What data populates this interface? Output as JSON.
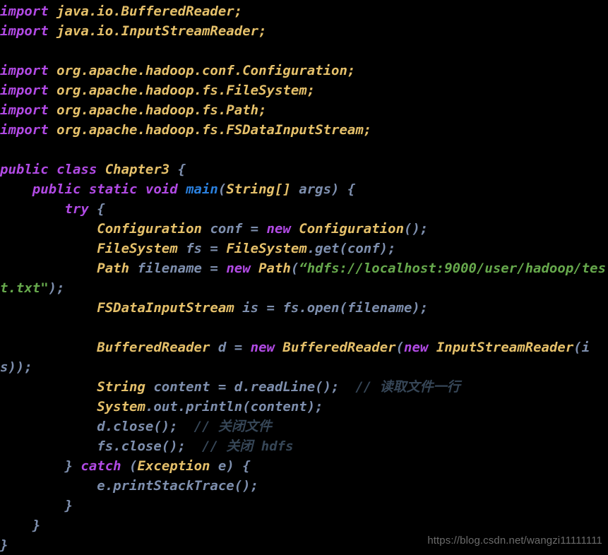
{
  "editor": {
    "background_color": "#000000",
    "language": "java",
    "font_size_px": 19,
    "line_height_px": 28
  },
  "palette": {
    "keyword": "#b14ae4",
    "type": "#e5c06a",
    "variable": "#7e8fae",
    "function": "#2a7fdc",
    "string": "#66a84c",
    "comment": "#364657",
    "punctuation": "#7e8fae",
    "watermark": "#6b6b6b"
  },
  "code": {
    "lines": [
      {
        "index": 1,
        "text": "import java.io.BufferedReader;",
        "tokens": [
          {
            "t": "import",
            "c": "t-kw"
          },
          {
            "t": " ",
            "c": "t-pun"
          },
          {
            "t": "java.io.BufferedReader;",
            "c": "t-type"
          }
        ]
      },
      {
        "index": 2,
        "text": "import java.io.InputStreamReader;",
        "tokens": [
          {
            "t": "import",
            "c": "t-kw"
          },
          {
            "t": " ",
            "c": "t-pun"
          },
          {
            "t": "java.io.InputStreamReader;",
            "c": "t-type"
          }
        ]
      },
      {
        "index": 3,
        "text": "",
        "tokens": []
      },
      {
        "index": 4,
        "text": "import org.apache.hadoop.conf.Configuration;",
        "tokens": [
          {
            "t": "import",
            "c": "t-kw"
          },
          {
            "t": " ",
            "c": "t-pun"
          },
          {
            "t": "org.apache.hadoop.conf.Configuration;",
            "c": "t-type"
          }
        ]
      },
      {
        "index": 5,
        "text": "import org.apache.hadoop.fs.FileSystem;",
        "tokens": [
          {
            "t": "import",
            "c": "t-kw"
          },
          {
            "t": " ",
            "c": "t-pun"
          },
          {
            "t": "org.apache.hadoop.fs.FileSystem;",
            "c": "t-type"
          }
        ]
      },
      {
        "index": 6,
        "text": "import org.apache.hadoop.fs.Path;",
        "tokens": [
          {
            "t": "import",
            "c": "t-kw"
          },
          {
            "t": " ",
            "c": "t-pun"
          },
          {
            "t": "org.apache.hadoop.fs.Path;",
            "c": "t-type"
          }
        ]
      },
      {
        "index": 7,
        "text": "import org.apache.hadoop.fs.FSDataInputStream;",
        "tokens": [
          {
            "t": "import",
            "c": "t-kw"
          },
          {
            "t": " ",
            "c": "t-pun"
          },
          {
            "t": "org.apache.hadoop.fs.FSDataInputStream;",
            "c": "t-type"
          }
        ]
      },
      {
        "index": 8,
        "text": "",
        "tokens": []
      },
      {
        "index": 9,
        "text": "public class Chapter3 {",
        "tokens": [
          {
            "t": "public class ",
            "c": "t-kw"
          },
          {
            "t": "Chapter3",
            "c": "t-type"
          },
          {
            "t": " {",
            "c": "t-pun"
          }
        ]
      },
      {
        "index": 10,
        "text": "    public static void main(String[] args) {",
        "tokens": [
          {
            "t": "    ",
            "c": "t-pun"
          },
          {
            "t": "public static void ",
            "c": "t-kw"
          },
          {
            "t": "main",
            "c": "t-fn"
          },
          {
            "t": "(",
            "c": "t-pun"
          },
          {
            "t": "String[]",
            "c": "t-type"
          },
          {
            "t": " args) {",
            "c": "t-pun"
          }
        ]
      },
      {
        "index": 11,
        "text": "        try {",
        "tokens": [
          {
            "t": "        ",
            "c": "t-pun"
          },
          {
            "t": "try",
            "c": "t-kw"
          },
          {
            "t": " {",
            "c": "t-pun"
          }
        ]
      },
      {
        "index": 12,
        "text": "            Configuration conf = new Configuration();",
        "tokens": [
          {
            "t": "            ",
            "c": "t-pun"
          },
          {
            "t": "Configuration",
            "c": "t-type"
          },
          {
            "t": " conf = ",
            "c": "t-var"
          },
          {
            "t": "new",
            "c": "t-kw"
          },
          {
            "t": " ",
            "c": "t-pun"
          },
          {
            "t": "Configuration",
            "c": "t-type"
          },
          {
            "t": "();",
            "c": "t-var"
          }
        ]
      },
      {
        "index": 13,
        "text": "            FileSystem fs = FileSystem.get(conf);",
        "tokens": [
          {
            "t": "            ",
            "c": "t-pun"
          },
          {
            "t": "FileSystem",
            "c": "t-type"
          },
          {
            "t": " fs = ",
            "c": "t-var"
          },
          {
            "t": "FileSystem",
            "c": "t-type"
          },
          {
            "t": ".get(conf);",
            "c": "t-var"
          }
        ]
      },
      {
        "index": 14,
        "text": "            Path filename = new Path(“hdfs://localhost:9000/user/hadoop/test.txt\");",
        "tokens": [
          {
            "t": "            ",
            "c": "t-pun"
          },
          {
            "t": "Path",
            "c": "t-type"
          },
          {
            "t": " filename = ",
            "c": "t-var"
          },
          {
            "t": "new",
            "c": "t-kw"
          },
          {
            "t": " ",
            "c": "t-pun"
          },
          {
            "t": "Path",
            "c": "t-type"
          },
          {
            "t": "(",
            "c": "t-var"
          },
          {
            "t": "“hdfs://localhost:9000/user/hadoop/test.txt\"",
            "c": "t-str"
          },
          {
            "t": ");",
            "c": "t-var"
          }
        ]
      },
      {
        "index": 15,
        "text": "            FSDataInputStream is = fs.open(filename);",
        "tokens": [
          {
            "t": "            ",
            "c": "t-pun"
          },
          {
            "t": "FSDataInputStream",
            "c": "t-type"
          },
          {
            "t": " is = fs.open(filename);",
            "c": "t-var"
          }
        ]
      },
      {
        "index": 16,
        "text": "",
        "tokens": []
      },
      {
        "index": 17,
        "text": "            BufferedReader d = new BufferedReader(new InputStreamReader(is));",
        "tokens": [
          {
            "t": "            ",
            "c": "t-pun"
          },
          {
            "t": "BufferedReader",
            "c": "t-type"
          },
          {
            "t": " d = ",
            "c": "t-var"
          },
          {
            "t": "new",
            "c": "t-kw"
          },
          {
            "t": " ",
            "c": "t-pun"
          },
          {
            "t": "BufferedReader",
            "c": "t-type"
          },
          {
            "t": "(",
            "c": "t-var"
          },
          {
            "t": "new",
            "c": "t-kw"
          },
          {
            "t": " ",
            "c": "t-pun"
          },
          {
            "t": "InputStreamReader",
            "c": "t-type"
          },
          {
            "t": "(is));",
            "c": "t-var"
          }
        ]
      },
      {
        "index": 18,
        "text": "            String content = d.readLine(); // 读取文件一行",
        "tokens": [
          {
            "t": "            ",
            "c": "t-pun"
          },
          {
            "t": "String",
            "c": "t-type"
          },
          {
            "t": " content = d.readLine();",
            "c": "t-var"
          },
          {
            "t": "  ",
            "c": "t-pun"
          },
          {
            "t": "// 读取文件一行",
            "c": "t-cmt"
          }
        ]
      },
      {
        "index": 19,
        "text": "            System.out.println(content);",
        "tokens": [
          {
            "t": "            ",
            "c": "t-pun"
          },
          {
            "t": "System",
            "c": "t-type"
          },
          {
            "t": ".out.println(content);",
            "c": "t-var"
          }
        ]
      },
      {
        "index": 20,
        "text": "            d.close(); // 关闭文件",
        "tokens": [
          {
            "t": "            ",
            "c": "t-pun"
          },
          {
            "t": "d.close();",
            "c": "t-var"
          },
          {
            "t": "  ",
            "c": "t-pun"
          },
          {
            "t": "// 关闭文件",
            "c": "t-cmt"
          }
        ]
      },
      {
        "index": 21,
        "text": "            fs.close(); // 关闭 hdfs",
        "tokens": [
          {
            "t": "            ",
            "c": "t-pun"
          },
          {
            "t": "fs.close();",
            "c": "t-var"
          },
          {
            "t": "  ",
            "c": "t-pun"
          },
          {
            "t": "// 关闭 hdfs",
            "c": "t-cmt"
          }
        ]
      },
      {
        "index": 22,
        "text": "        } catch (Exception e) {",
        "tokens": [
          {
            "t": "        } ",
            "c": "t-pun"
          },
          {
            "t": "catch",
            "c": "t-kw"
          },
          {
            "t": " (",
            "c": "t-pun"
          },
          {
            "t": "Exception",
            "c": "t-type"
          },
          {
            "t": " e) {",
            "c": "t-pun"
          }
        ]
      },
      {
        "index": 23,
        "text": "            e.printStackTrace();",
        "tokens": [
          {
            "t": "            ",
            "c": "t-pun"
          },
          {
            "t": "e.printStackTrace();",
            "c": "t-var"
          }
        ]
      },
      {
        "index": 24,
        "text": "        }",
        "tokens": [
          {
            "t": "        }",
            "c": "t-pun"
          }
        ]
      },
      {
        "index": 25,
        "text": "    }",
        "tokens": [
          {
            "t": "    }",
            "c": "t-pun"
          }
        ]
      },
      {
        "index": 26,
        "text": "}",
        "tokens": [
          {
            "t": "}",
            "c": "t-pun"
          }
        ]
      }
    ]
  },
  "watermark": {
    "text": "https://blog.csdn.net/wangzi11111111"
  }
}
